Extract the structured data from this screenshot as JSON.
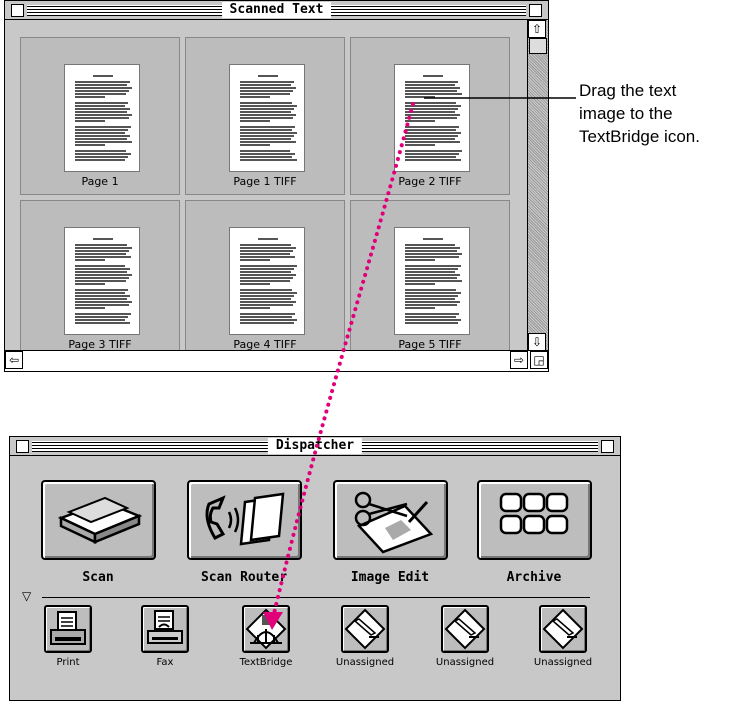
{
  "scanned_window": {
    "title": "Scanned Text",
    "pages": [
      {
        "label": "Page 1"
      },
      {
        "label": "Page 1 TIFF"
      },
      {
        "label": "Page 2 TIFF"
      },
      {
        "label": "Page 3 TIFF"
      },
      {
        "label": "Page 4 TIFF"
      },
      {
        "label": "Page 5 TIFF"
      }
    ]
  },
  "callout": {
    "line1": "Drag the text",
    "line2": "image to the",
    "line3": "TextBridge icon."
  },
  "dispatcher": {
    "title": "Dispatcher",
    "main_buttons": [
      {
        "label": "Scan",
        "icon": "scanner-icon"
      },
      {
        "label": "Scan Router",
        "icon": "phone-documents-icon"
      },
      {
        "label": "Image Edit",
        "icon": "scissors-image-icon"
      },
      {
        "label": "Archive",
        "icon": "archive-grid-icon"
      }
    ],
    "small_buttons": [
      {
        "label": "Print",
        "icon": "printer-icon"
      },
      {
        "label": "Fax",
        "icon": "fax-icon"
      },
      {
        "label": "TextBridge",
        "icon": "textbridge-icon"
      },
      {
        "label": "Unassigned",
        "icon": "pen-diamond-icon"
      },
      {
        "label": "Unassigned",
        "icon": "pen-diamond-icon"
      },
      {
        "label": "Unassigned",
        "icon": "pen-diamond-icon"
      }
    ]
  },
  "colors": {
    "drag_path": "#e0007a",
    "window_bg": "#c8c8c8"
  }
}
